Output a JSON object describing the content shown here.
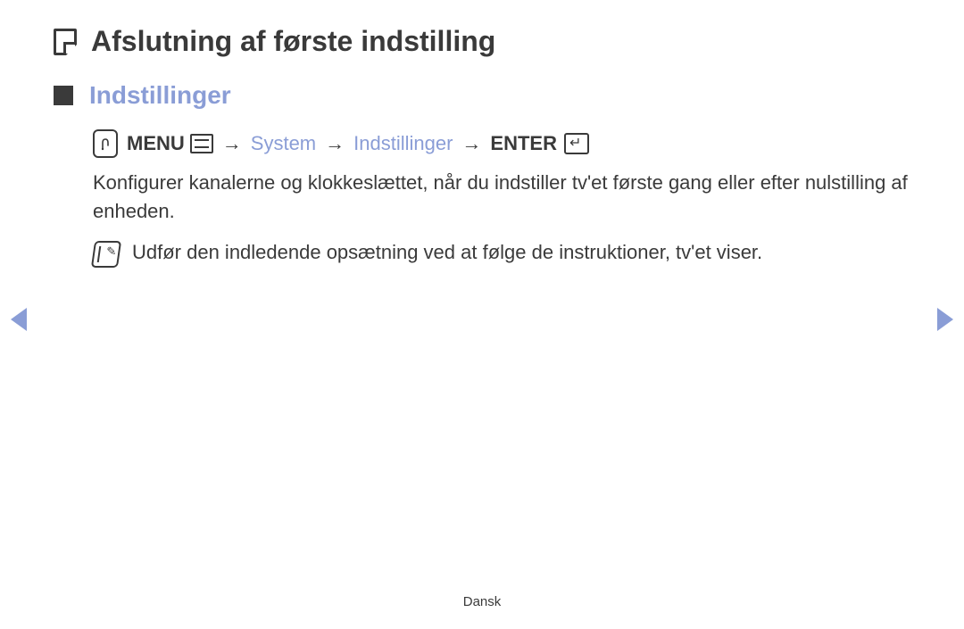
{
  "page": {
    "title": "Afslutning af første indstilling"
  },
  "section": {
    "title": "Indstillinger"
  },
  "navpath": {
    "menu_label": "MENU",
    "sep": "→",
    "system": "System",
    "indstillinger": "Indstillinger",
    "enter_label": "ENTER"
  },
  "body": {
    "description": "Konfigurer kanalerne og klokkeslættet, når du indstiller tv'et første gang eller efter nulstilling af enheden.",
    "note": "Udfør den indledende opsætning ved at følge de instruktioner, tv'et viser."
  },
  "footer": {
    "language": "Dansk"
  }
}
